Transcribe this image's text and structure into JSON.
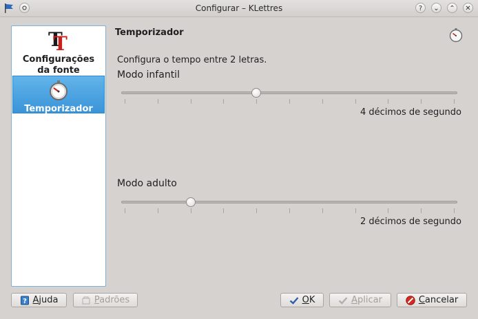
{
  "window": {
    "title": "Configurar – KLettres"
  },
  "titlebar_buttons": [
    "?",
    "⌄",
    "⌃",
    "✕"
  ],
  "sidebar": {
    "items": [
      {
        "label": "Configurações da fonte",
        "icon": "font-tt-icon",
        "selected": false
      },
      {
        "label": "Temporizador",
        "icon": "stopwatch-icon",
        "selected": true
      }
    ]
  },
  "page": {
    "title": "Temporizador",
    "icon": "stopwatch-icon",
    "description": "Configura o tempo entre 2 letras.",
    "kid": {
      "label": "Modo infantil",
      "value": 4,
      "min": 0,
      "max": 10,
      "value_text": "4 décimos de segundo"
    },
    "adult": {
      "label": "Modo adulto",
      "value": 2,
      "min": 0,
      "max": 10,
      "value_text": "2 décimos de segundo"
    }
  },
  "buttons": {
    "help": {
      "prefix": "",
      "mnemonic": "A",
      "rest": "juda"
    },
    "defaults": {
      "prefix": "",
      "mnemonic": "P",
      "rest": "adrões"
    },
    "ok": {
      "prefix": "",
      "mnemonic": "O",
      "rest": "K"
    },
    "apply": {
      "prefix": "",
      "mnemonic": "A",
      "rest": "plicar"
    },
    "cancel": {
      "prefix": "",
      "mnemonic": "C",
      "rest": "ancelar"
    }
  }
}
